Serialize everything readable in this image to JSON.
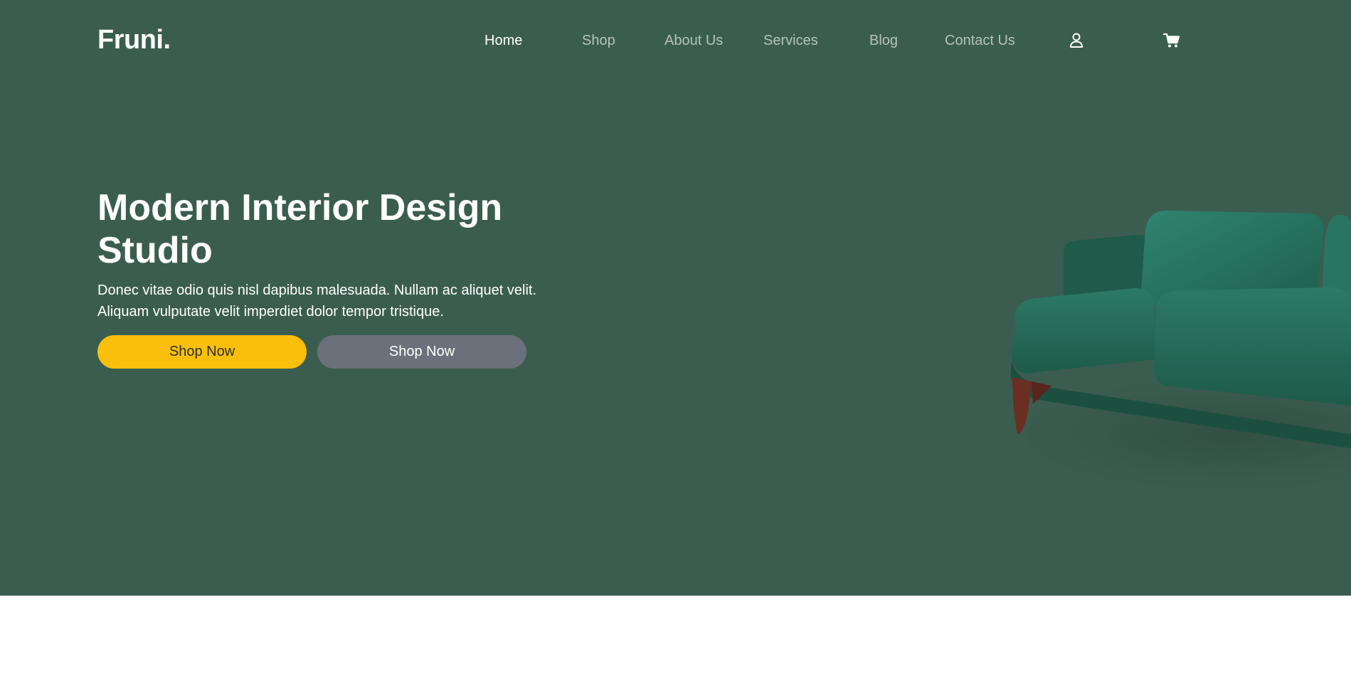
{
  "header": {
    "logo": "Fruni."
  },
  "nav": {
    "items": [
      {
        "label": "Home",
        "active": true
      },
      {
        "label": "Shop",
        "active": false
      },
      {
        "label": "About Us",
        "active": false
      },
      {
        "label": "Services",
        "active": false
      },
      {
        "label": "Blog",
        "active": false
      },
      {
        "label": "Contact Us",
        "active": false
      }
    ],
    "icons": [
      "user-icon",
      "cart-icon"
    ]
  },
  "hero": {
    "title": "Modern Interior Design Studio",
    "description": "Donec vitae odio quis nisl dapibus malesuada. Nullam ac aliquet velit. Aliquam vulputate velit imperdiet dolor tempor tristique.",
    "primary_button": "Shop Now",
    "secondary_button": "Shop Now",
    "image": "green-velvet-sofa"
  },
  "colors": {
    "hero_background": "#3b5d50",
    "accent": "#f9bf0a",
    "secondary_button": "#6b717a",
    "page_background": "#ffffff"
  }
}
